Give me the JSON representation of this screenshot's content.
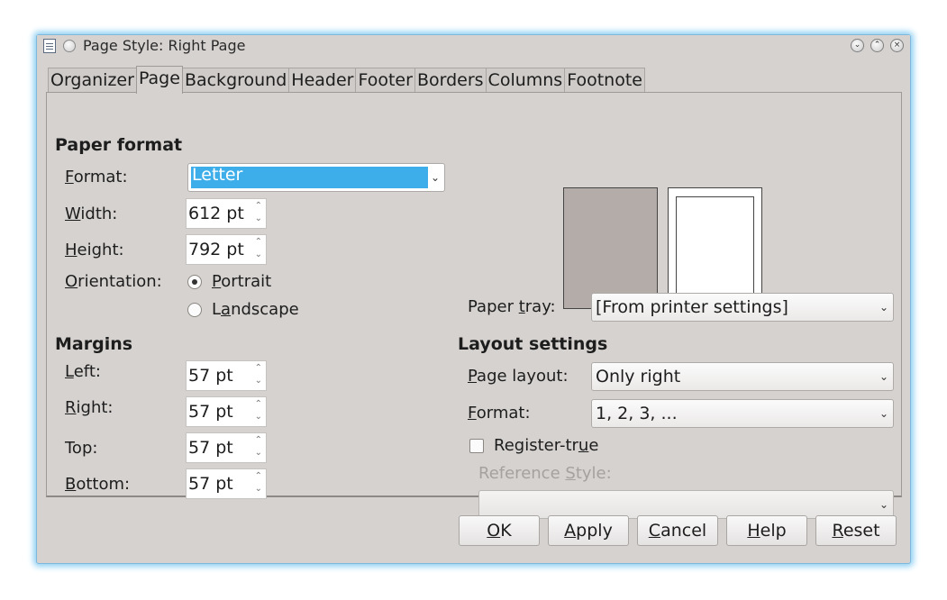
{
  "window": {
    "title": "Page Style: Right Page",
    "icons": [
      "document-icon",
      "pin-icon"
    ],
    "controls": [
      {
        "name": "minimize",
        "glyph": "⌄"
      },
      {
        "name": "maximize",
        "glyph": "⌃"
      },
      {
        "name": "close",
        "glyph": "×"
      }
    ]
  },
  "tabs": [
    {
      "label": "Organizer"
    },
    {
      "label": "Page",
      "active": true
    },
    {
      "label": "Background"
    },
    {
      "label": "Header"
    },
    {
      "label": "Footer"
    },
    {
      "label": "Borders"
    },
    {
      "label": "Columns"
    },
    {
      "label": "Footnote"
    }
  ],
  "paper_format": {
    "heading": "Paper format",
    "format": {
      "label_u": "F",
      "label_rest": "ormat:",
      "value": "Letter"
    },
    "width": {
      "label_u": "W",
      "label_rest": "idth:",
      "value": "612 pt"
    },
    "height": {
      "label_u": "H",
      "label_rest": "eight:",
      "value": "792 pt"
    },
    "orientation": {
      "label_u": "O",
      "label_rest": "rientation:",
      "portrait_u": "P",
      "portrait_rest": "ortrait",
      "landscape_pre": "L",
      "landscape_u": "a",
      "landscape_rest": "ndscape",
      "selected": "Portrait"
    },
    "paper_tray": {
      "label_pre": "Paper ",
      "label_u": "t",
      "label_rest": "ray:",
      "value": "[From printer settings]"
    }
  },
  "margins": {
    "heading": "Margins",
    "left": {
      "label_u": "L",
      "label_rest": "eft:",
      "value": "57 pt"
    },
    "right": {
      "label_u": "R",
      "label_rest": "ight:",
      "value": "57 pt"
    },
    "top": {
      "label": "Top:",
      "value": "57 pt"
    },
    "bottom": {
      "label_u": "B",
      "label_rest": "ottom:",
      "value": "57 pt"
    }
  },
  "layout_settings": {
    "heading": "Layout settings",
    "page_layout": {
      "label_u": "P",
      "label_rest": "age layout:",
      "value": "Only right"
    },
    "format": {
      "label_u": "F",
      "label_rest": "ormat:",
      "value": "1, 2, 3, ..."
    },
    "register_true": {
      "label_pre": "Register-tr",
      "label_u": "u",
      "label_rest": "e",
      "checked": false
    },
    "reference_style": {
      "label_pre": "Reference ",
      "label_u": "S",
      "label_rest": "tyle:",
      "value": ""
    }
  },
  "buttons": {
    "ok": {
      "u": "O",
      "rest": "K"
    },
    "apply": {
      "u": "A",
      "rest": "pply"
    },
    "cancel": {
      "u": "C",
      "rest": "ancel"
    },
    "help": {
      "u": "H",
      "rest": "elp"
    },
    "reset": {
      "u": "R",
      "rest": "eset"
    }
  },
  "colors": {
    "accent": "#3daee9",
    "window_glow": "#8fd0f3",
    "dialog_bg": "#d6d2d0",
    "preview_gray": "#b4aca9"
  }
}
